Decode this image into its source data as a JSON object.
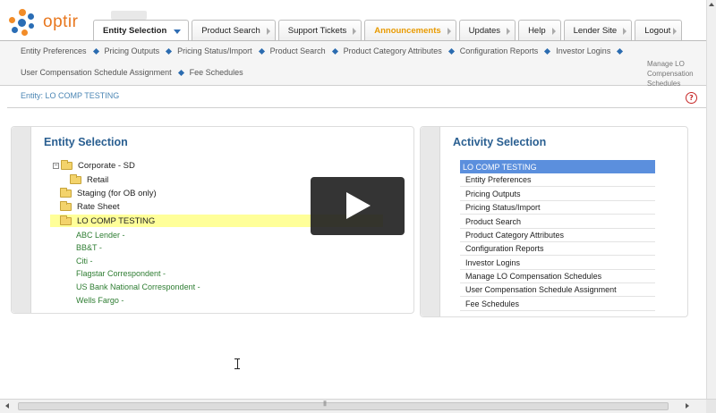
{
  "brand": {
    "name": "optir"
  },
  "tabs": [
    {
      "label": "Entity Selection",
      "active": true
    },
    {
      "label": "Product Search"
    },
    {
      "label": "Support Tickets"
    },
    {
      "label": "Announcements",
      "highlight": true
    },
    {
      "label": "Updates"
    },
    {
      "label": "Help"
    },
    {
      "label": "Lender Site"
    },
    {
      "label": "Logout"
    }
  ],
  "submenu": {
    "row1": [
      "Entity Preferences",
      "Pricing Outputs",
      "Pricing Status/Import",
      "Product Search",
      "Product Category Attributes",
      "Configuration Reports",
      "Investor Logins"
    ],
    "row2": [
      "User Compensation Schedule Assignment",
      "Fee Schedules"
    ],
    "overflow_label": "Manage LO Compensation Schedules"
  },
  "entity_bar": {
    "text": "Entity: LO COMP TESTING",
    "help_symbol": "?"
  },
  "entity_selection": {
    "title": "Entity Selection",
    "expander_symbol": "−",
    "folders": [
      {
        "label": "Corporate - SD"
      },
      {
        "label": "Retail"
      },
      {
        "label": "Staging (for OB only)"
      },
      {
        "label": "Rate Sheet"
      },
      {
        "label": "LO COMP TESTING",
        "highlighted": true
      }
    ],
    "links": [
      "ABC Lender -",
      "BB&T -",
      "Citi -",
      "Flagstar Correspondent -",
      "US Bank National Correspondent -",
      "Wells Fargo -"
    ]
  },
  "activity_selection": {
    "title": "Activity Selection",
    "items": [
      {
        "label": "LO COMP TESTING",
        "selected": true
      },
      {
        "label": "Entity Preferences"
      },
      {
        "label": "Pricing Outputs"
      },
      {
        "label": "Pricing Status/Import"
      },
      {
        "label": "Product Search"
      },
      {
        "label": "Product Category Attributes"
      },
      {
        "label": "Configuration Reports"
      },
      {
        "label": "Investor Logins"
      },
      {
        "label": "Manage LO Compensation Schedules"
      },
      {
        "label": "User Compensation Schedule Assignment"
      },
      {
        "label": "Fee Schedules"
      }
    ]
  },
  "icons": {
    "play": "play-icon",
    "help": "help-icon",
    "folder": "folder-icon",
    "submenu_separator": "diamond-icon",
    "cursor": "text-cursor-icon"
  },
  "colors": {
    "brand_orange": "#e8771e",
    "title_blue": "#2a5f91",
    "selected_blue": "#5b8fdd",
    "link_green": "#2e7d32",
    "highlight_yellow": "#ffff99",
    "announcement_orange": "#e89a00"
  }
}
